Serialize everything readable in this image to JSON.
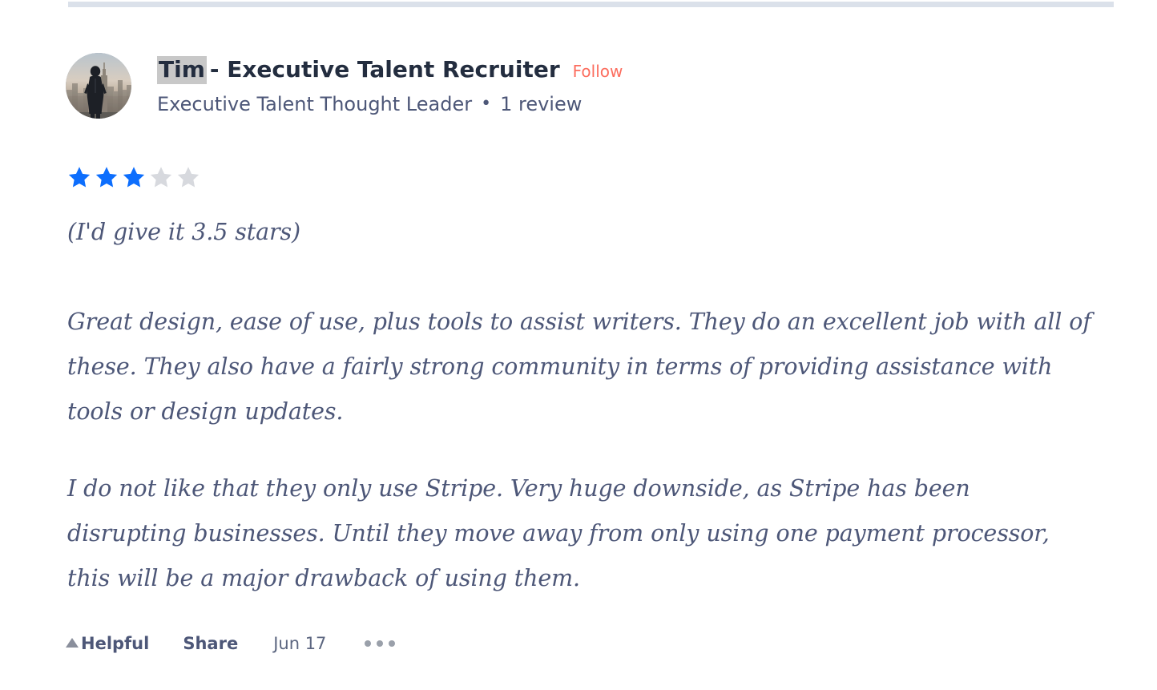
{
  "divider": {
    "color": "#dbe1ea"
  },
  "review": {
    "avatar": {
      "alt": "Man in suit viewed from behind overlooking a city skyline"
    },
    "reviewer": {
      "name_selected": "Tim",
      "name_rest": "- Executive Talent Recruiter",
      "follow_label": "Follow",
      "follow_color": "#fc6d5e",
      "headline": "Executive Talent Thought Leader",
      "separator": "•",
      "review_count": "1 review"
    },
    "rating": {
      "value": 3,
      "max": 5,
      "filled_color": "#0d6efd",
      "empty_color": "#d7d9de"
    },
    "body": {
      "lead": "(I'd give it 3.5 stars)",
      "paragraphs": [
        "Great design, ease of use, plus tools to assist writers. They do an excellent job with all of these. They also have a fairly strong community in terms of providing assistance with tools or design updates.",
        "I do not like that they only use Stripe. Very huge downside, as Stripe has been disrupting businesses. Until they move away from only using one payment processor, this will be a major drawback of using them."
      ]
    },
    "actions": {
      "helpful_label": "Helpful",
      "share_label": "Share",
      "date": "Jun 17",
      "more_label": "•••"
    }
  }
}
